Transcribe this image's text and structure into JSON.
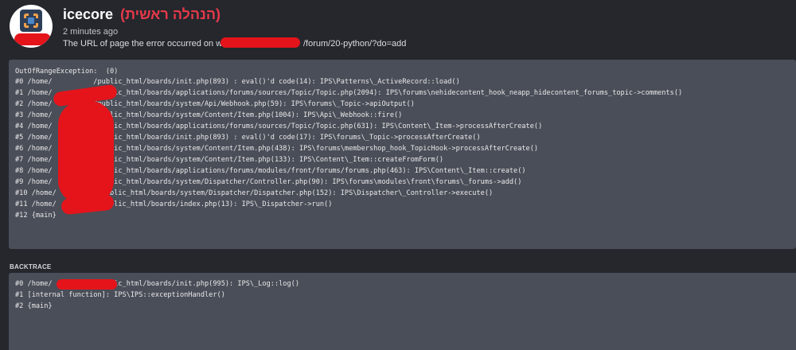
{
  "post": {
    "author_name": "icecore",
    "author_group": "(הנהלה ראשית)",
    "time": "2 minutes ago",
    "url_prefix": "The URL of page the error occurred on was",
    "url_suffix": "/forum/20-python/?do=add"
  },
  "colors": {
    "background": "#25272d",
    "panel": "#4a4e58",
    "group_accent": "#e8394a",
    "redaction": "#e5141b"
  },
  "trace": {
    "lines": [
      "OutOfRangeException:  (0)",
      "#0 /home/          /public_html/boards/init.php(893) : eval()'d code(14): IPS\\Patterns\\_ActiveRecord::load()",
      "#1 /home/          /public_html/boards/applications/forums/sources/Topic/Topic.php(2094): IPS\\forums\\nehidecontent_hook_neapp_hidecontent_forums_topic->comments()",
      "#2 /home/          /public_html/boards/system/Api/Webhook.php(59): IPS\\forums\\_Topic->apiOutput()",
      "#3 /home/          /public_html/boards/system/Content/Item.php(1004): IPS\\Api\\_Webhook::fire()",
      "#4 /home/          /public_html/boards/applications/forums/sources/Topic/Topic.php(631): IPS\\Content\\_Item->processAfterCreate()",
      "#5 /home/          /public_html/boards/init.php(893) : eval()'d code(17): IPS\\forums\\_Topic->processAfterCreate()",
      "#6 /home/          /public_html/boards/system/Content/Item.php(438): IPS\\forums\\membershop_hook_TopicHook->processAfterCreate()",
      "#7 /home/          /public_html/boards/system/Content/Item.php(133): IPS\\Content\\_Item::createFromForm()",
      "#8 /home/          /public_html/boards/applications/forums/modules/front/forums/forums.php(463): IPS\\Content\\_Item::create()",
      "#9 /home/          /public_html/boards/system/Dispatcher/Controller.php(90): IPS\\forums\\modules\\front\\forums\\_forums->add()",
      "#10 /home/          /public_html/boards/system/Dispatcher/Dispatcher.php(152): IPS\\Dispatcher\\_Controller->execute()",
      "#11 /home/          /public_html/boards/index.php(13): IPS\\_Dispatcher->run()",
      "#12 {main}"
    ]
  },
  "backtrace": {
    "label": "BACKTRACE",
    "lines": [
      "#0 /home/          /public_html/boards/init.php(995): IPS\\_Log::log()",
      "#1 [internal function]: IPS\\IPS::exceptionHandler()",
      "#2 {main}"
    ]
  }
}
